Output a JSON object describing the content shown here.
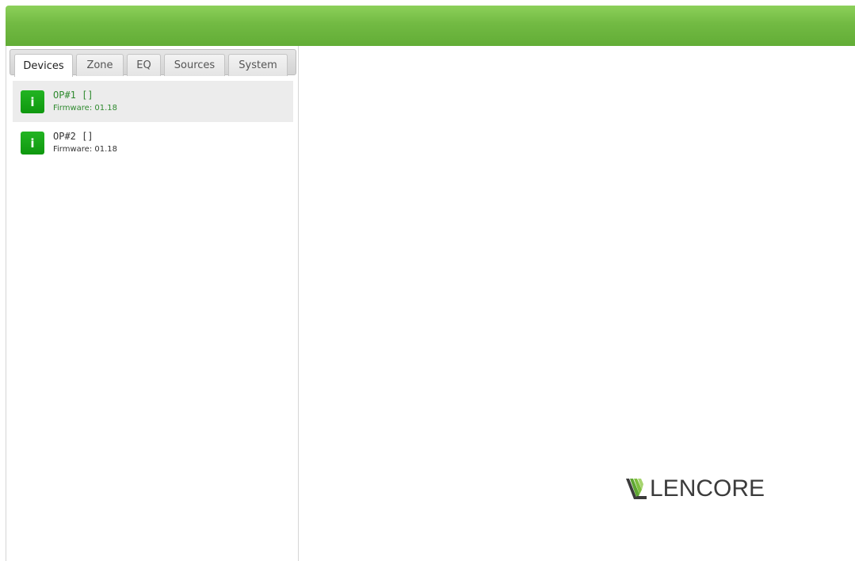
{
  "tabs": [
    {
      "label": "Devices",
      "active": true
    },
    {
      "label": "Zone",
      "active": false
    },
    {
      "label": "EQ",
      "active": false
    },
    {
      "label": "Sources",
      "active": false
    },
    {
      "label": "System",
      "active": false
    }
  ],
  "devices": [
    {
      "name": "OP#1 []",
      "firmware": "Firmware: 01.18",
      "icon_glyph": "i",
      "icon": "info-icon",
      "selected": true
    },
    {
      "name": "OP#2 []",
      "firmware": "Firmware: 01.18",
      "icon_glyph": "i",
      "icon": "info-icon",
      "selected": false
    }
  ],
  "brand": {
    "logo_text": "LENCORE",
    "logo_icon": "lencore-mark-icon"
  },
  "colors": {
    "header_green": "#72ba43",
    "icon_green": "#18a618",
    "selected_text_green": "#2f8a2f",
    "logo_mark_green": "#7fbf3f"
  }
}
